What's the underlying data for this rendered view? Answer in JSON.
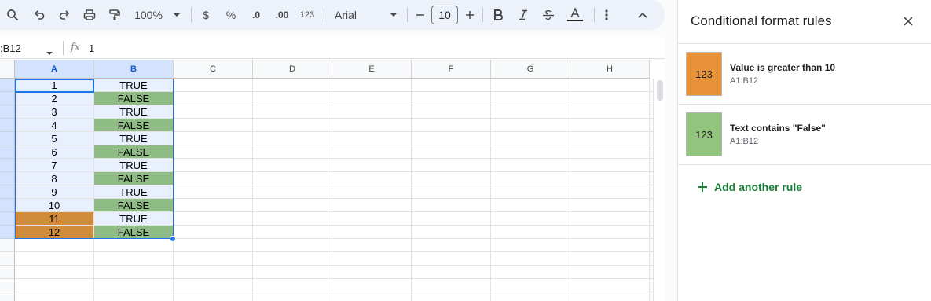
{
  "toolbar": {
    "zoom": "100%",
    "currency": "$",
    "percent": "%",
    "decrease_decimal": ".0",
    "increase_decimal": ".00",
    "number_format": "123",
    "font": "Arial",
    "font_size": "10",
    "icons": [
      "search-icon",
      "undo-icon",
      "redo-icon",
      "print-icon",
      "paint-format-icon",
      "minus-icon",
      "plus-icon",
      "bold-icon",
      "italic-icon",
      "strikethrough-icon",
      "text-color-icon",
      "more-icon",
      "collapse-icon"
    ]
  },
  "formula_bar": {
    "name_box": ":B12",
    "fx": "fx",
    "value": "1"
  },
  "grid": {
    "columns": [
      "A",
      "B",
      "C",
      "D",
      "E",
      "F",
      "G",
      "H"
    ],
    "rows": [
      {
        "a": "1",
        "b": "TRUE",
        "a_color": "",
        "b_color": ""
      },
      {
        "a": "2",
        "b": "FALSE",
        "a_color": "",
        "b_color": "green"
      },
      {
        "a": "3",
        "b": "TRUE",
        "a_color": "",
        "b_color": ""
      },
      {
        "a": "4",
        "b": "FALSE",
        "a_color": "",
        "b_color": "green"
      },
      {
        "a": "5",
        "b": "TRUE",
        "a_color": "",
        "b_color": ""
      },
      {
        "a": "6",
        "b": "FALSE",
        "a_color": "",
        "b_color": "green"
      },
      {
        "a": "7",
        "b": "TRUE",
        "a_color": "",
        "b_color": ""
      },
      {
        "a": "8",
        "b": "FALSE",
        "a_color": "",
        "b_color": "green"
      },
      {
        "a": "9",
        "b": "TRUE",
        "a_color": "",
        "b_color": ""
      },
      {
        "a": "10",
        "b": "FALSE",
        "a_color": "",
        "b_color": "green"
      },
      {
        "a": "11",
        "b": "TRUE",
        "a_color": "orange",
        "b_color": ""
      },
      {
        "a": "12",
        "b": "FALSE",
        "a_color": "orange",
        "b_color": "green"
      }
    ]
  },
  "panel": {
    "title": "Conditional format rules",
    "rules": [
      {
        "preview": "123",
        "title": "Value is greater than 10",
        "range": "A1:B12",
        "color": "#e8923a"
      },
      {
        "preview": "123",
        "title": "Text contains \"False\"",
        "range": "A1:B12",
        "color": "#93c47d"
      }
    ],
    "add_rule": "Add another rule",
    "colors": {
      "accent": "#188038",
      "selection": "#1a73e8"
    }
  }
}
